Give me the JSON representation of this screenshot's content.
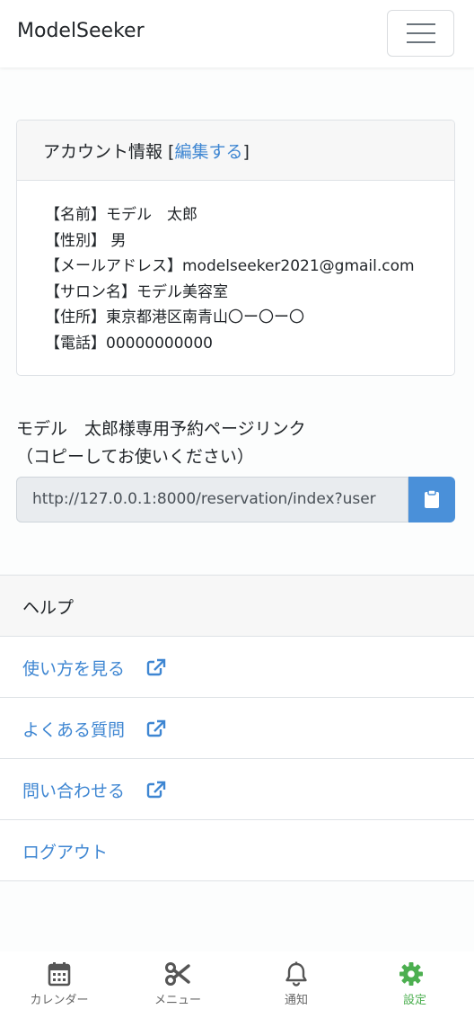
{
  "app": {
    "brand": "ModelSeeker"
  },
  "account": {
    "header_prefix": "アカウント情報 [",
    "edit_link": "編集する",
    "header_suffix": "]",
    "lines": [
      "【名前】モデル　太郎",
      "【性別】 男",
      "【メールアドレス】modelseeker2021@gmail.com",
      "【サロン名】モデル美容室",
      "【住所】東京都港区南青山〇ー〇ー〇",
      "【電話】00000000000"
    ]
  },
  "reservation": {
    "title_line1": "モデル　太郎様専用予約ページリンク",
    "title_line2": "（コピーしてお使いください）",
    "url": "http://127.0.0.1:8000/reservation/index?user"
  },
  "help": {
    "header": "ヘルプ",
    "items": [
      {
        "label": "使い方を見る",
        "external": true
      },
      {
        "label": "よくある質問",
        "external": true
      },
      {
        "label": "問い合わせる",
        "external": true
      },
      {
        "label": "ログアウト",
        "external": false
      }
    ]
  },
  "bottom_nav": {
    "items": [
      {
        "label": "カレンダー",
        "icon": "calendar-icon",
        "active": false
      },
      {
        "label": "メニュー",
        "icon": "scissors-icon",
        "active": false
      },
      {
        "label": "通知",
        "icon": "bell-icon",
        "active": false
      },
      {
        "label": "設定",
        "icon": "gear-icon",
        "active": true
      }
    ]
  },
  "colors": {
    "link": "#3e86d2",
    "primary_button": "#4a90d9",
    "active_nav": "#4caf50",
    "nav_icon": "#555555"
  }
}
